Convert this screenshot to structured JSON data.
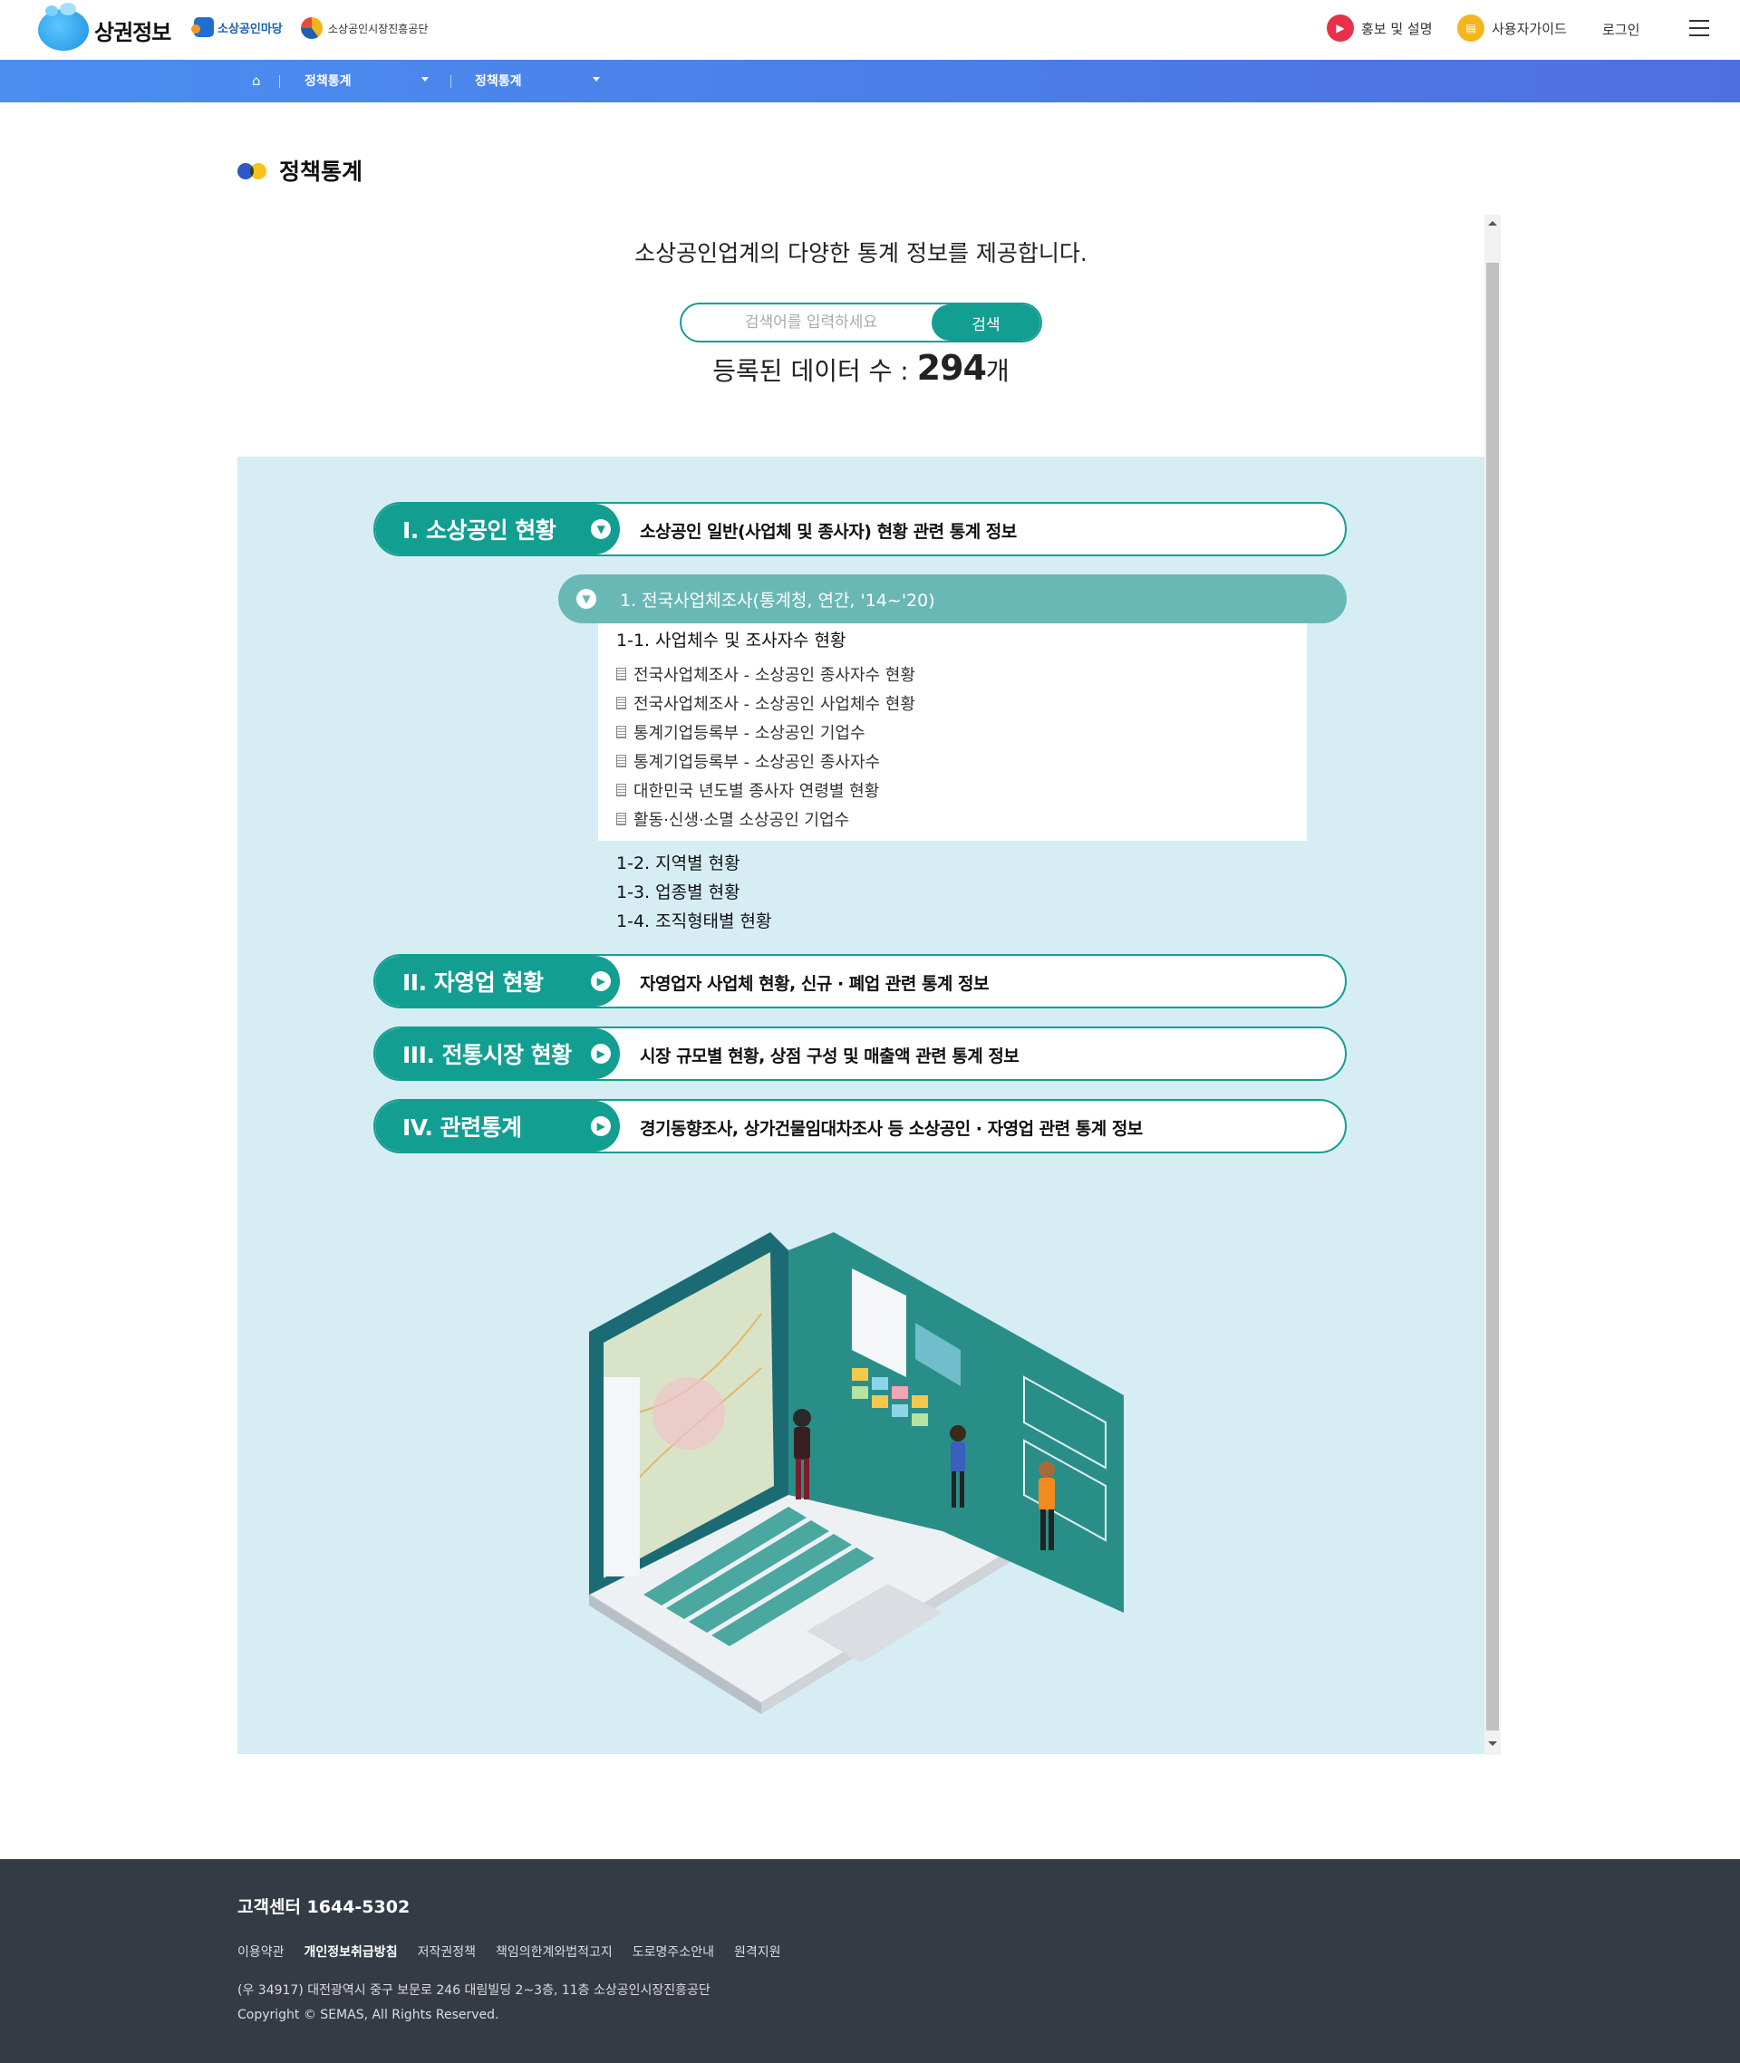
{
  "header": {
    "logo_text": "상권정보",
    "partner1": "소상공인마당",
    "partner2": "소상공인시장진흥공단",
    "promo_label": "홍보 및 설명",
    "guide_label": "사용자가이드",
    "login_label": "로그인",
    "icons": {
      "promo": "play-icon",
      "guide": "book-icon",
      "menu": "hamburger-icon"
    },
    "colors": {
      "promo": "#e8304a",
      "guide": "#f5b51e"
    }
  },
  "nav": {
    "item1": "정책통계",
    "item2": "정책통계",
    "bar_color": "#4a8ef0"
  },
  "page": {
    "title": "정책통계",
    "intro": "소상공인업계의 다양한 통계 정보를 제공합니다.",
    "search_placeholder": "검색어를 입력하세요",
    "search_button": "검색",
    "count_prefix": "등록된 데이터 수 : ",
    "count_value": "294",
    "count_suffix": "개"
  },
  "categories": [
    {
      "label": "I. 소상공인 현황",
      "desc": "소상공인 일반(사업체 및 종사자) 현황 관련 통계 정보",
      "expanded": true
    },
    {
      "label": "II. 자영업 현황",
      "desc": "자영업자 사업체 현황, 신규 · 폐업 관련 통계 정보",
      "expanded": false
    },
    {
      "label": "III. 전통시장 현황",
      "desc": "시장 규모별 현황, 상점 구성 및 매출액 관련 통계 정보",
      "expanded": false
    },
    {
      "label": "IV. 관련통계",
      "desc": "경기동향조사, 상가건물임대차조사 등 소상공인 · 자영업 관련 통계 정보",
      "expanded": false
    }
  ],
  "survey": {
    "label": "1. 전국사업체조사(통계청, 연간, '14~'20)",
    "section_head": "1-1. 사업체수 및 조사자수 현황",
    "items": [
      "전국사업체조사 - 소상공인 종사자수 현황",
      "전국사업체조사 - 소상공인 사업체수 현황",
      "통계기업등록부 - 소상공인 기업수",
      "통계기업등록부 - 소상공인 종사자수",
      "대한민국 년도별 종사자 연령별 현황",
      "활동·신생·소멸 소상공인 기업수"
    ],
    "other_sections": [
      "1-2. 지역별 현황",
      "1-3. 업종별 현황",
      "1-4. 조직형태별 현황"
    ]
  },
  "footer": {
    "cs": "고객센터 1644-5302",
    "links": [
      "이용약관",
      "개인정보취급방침",
      "저작권정책",
      "책임의한계와법적고지",
      "도로명주소안내",
      "원격지원"
    ],
    "address": "(우 34917) 대전광역시 중구 보문로 246 대림빌딩 2~3층, 11층 소상공인시장진흥공단",
    "copyright": "Copyright © SEMAS, All Rights Reserved."
  }
}
